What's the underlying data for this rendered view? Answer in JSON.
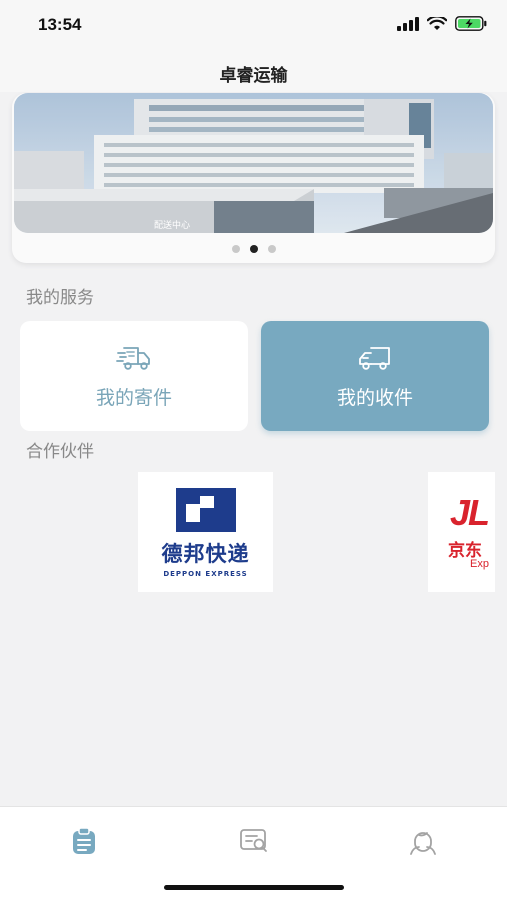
{
  "status_bar": {
    "time": "13:54",
    "icons": [
      "signal-icon",
      "wifi-icon",
      "battery-charging-icon"
    ]
  },
  "header": {
    "title": "卓睿运输"
  },
  "banner": {
    "sign_text": "配送中心",
    "slides": 3,
    "active_slide": 2
  },
  "services": {
    "section_title": "我的服务",
    "send": {
      "label": "我的寄件",
      "icon": "delivery-truck-icon"
    },
    "receive": {
      "label": "我的收件",
      "icon": "truck-icon"
    }
  },
  "partners": {
    "section_title": "合作伙伴",
    "items": [
      {
        "name": "德邦快递",
        "subtitle": "DEPPON EXPRESS"
      },
      {
        "mark": "JL",
        "name": "京东",
        "subtitle": "Exp"
      }
    ]
  },
  "tab_bar": {
    "tabs": [
      {
        "icon": "clipboard-icon",
        "active": true
      },
      {
        "icon": "search-document-icon",
        "active": false
      },
      {
        "icon": "user-icon",
        "active": false
      }
    ]
  },
  "colors": {
    "accent": "#78a9c0",
    "background": "#f2f2f3",
    "deppon_blue": "#1e3c8c",
    "jd_red": "#d9232d"
  }
}
